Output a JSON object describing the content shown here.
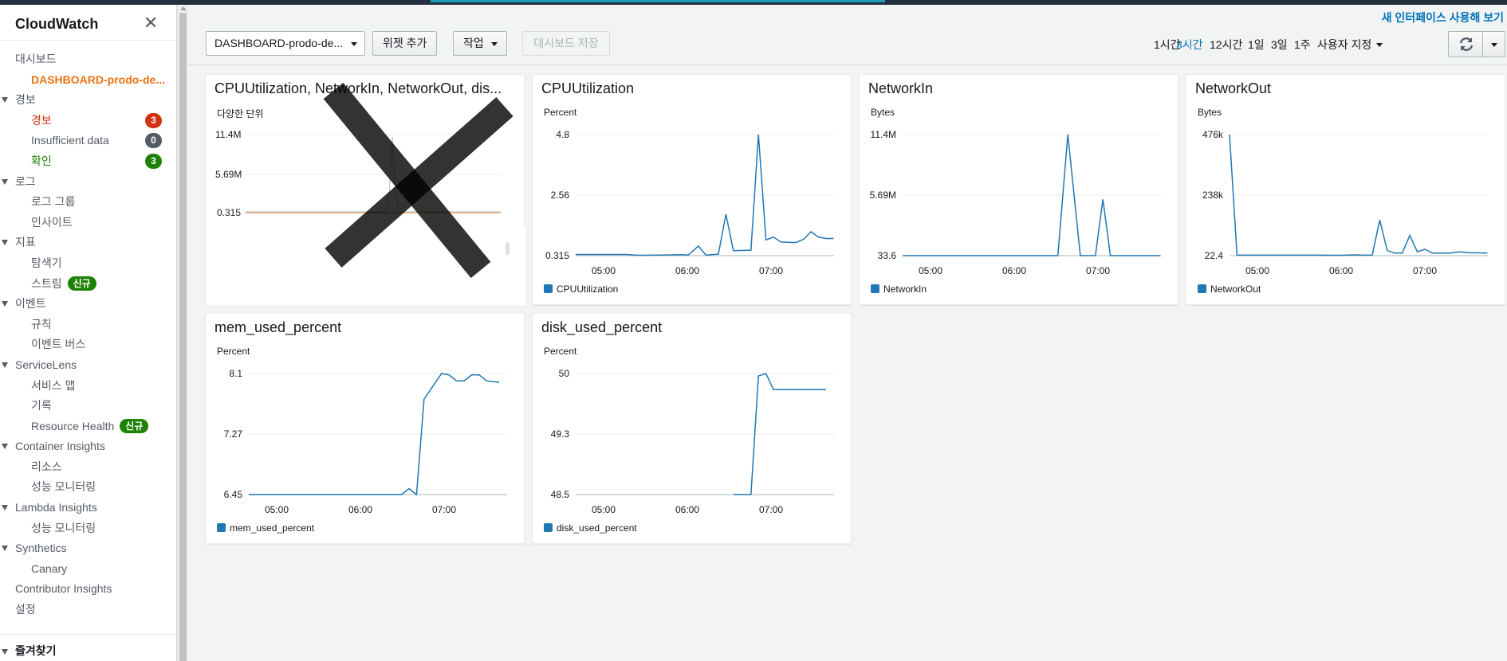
{
  "sidebar": {
    "title": "CloudWatch",
    "items": [
      {
        "label": "대시보드",
        "level": 1,
        "caret": false,
        "style": ""
      },
      {
        "label": "DASHBOARD-prodo-de...",
        "level": 2,
        "caret": false,
        "style": "active"
      },
      {
        "label": "경보",
        "level": 1,
        "caret": true,
        "style": ""
      },
      {
        "label": "경보",
        "level": 2,
        "caret": false,
        "style": "alarm",
        "count": "3",
        "count_color": "red"
      },
      {
        "label": "Insufficient data",
        "level": 2,
        "caret": false,
        "style": "",
        "count": "0",
        "count_color": "gray"
      },
      {
        "label": "확인",
        "level": 2,
        "caret": false,
        "style": "ok",
        "count": "3",
        "count_color": "green"
      },
      {
        "label": "로그",
        "level": 1,
        "caret": true,
        "style": ""
      },
      {
        "label": "로그 그룹",
        "level": 2,
        "caret": false,
        "style": ""
      },
      {
        "label": "인사이트",
        "level": 2,
        "caret": false,
        "style": ""
      },
      {
        "label": "지표",
        "level": 1,
        "caret": true,
        "style": ""
      },
      {
        "label": "탐색기",
        "level": 2,
        "caret": false,
        "style": ""
      },
      {
        "label": "스트림",
        "level": 2,
        "caret": false,
        "style": "",
        "badge": "신규"
      },
      {
        "label": "이벤트",
        "level": 1,
        "caret": true,
        "style": ""
      },
      {
        "label": "규칙",
        "level": 2,
        "caret": false,
        "style": ""
      },
      {
        "label": "이벤트 버스",
        "level": 2,
        "caret": false,
        "style": ""
      },
      {
        "label": "ServiceLens",
        "level": 1,
        "caret": true,
        "style": ""
      },
      {
        "label": "서비스 맵",
        "level": 2,
        "caret": false,
        "style": ""
      },
      {
        "label": "기록",
        "level": 2,
        "caret": false,
        "style": ""
      },
      {
        "label": "Resource Health",
        "level": 2,
        "caret": false,
        "style": "",
        "badge": "신규"
      },
      {
        "label": "Container Insights",
        "level": 1,
        "caret": true,
        "style": ""
      },
      {
        "label": "리소스",
        "level": 2,
        "caret": false,
        "style": ""
      },
      {
        "label": "성능 모니터링",
        "level": 2,
        "caret": false,
        "style": ""
      },
      {
        "label": "Lambda Insights",
        "level": 1,
        "caret": true,
        "style": ""
      },
      {
        "label": "성능 모니터링",
        "level": 2,
        "caret": false,
        "style": ""
      },
      {
        "label": "Synthetics",
        "level": 1,
        "caret": true,
        "style": ""
      },
      {
        "label": "Canary",
        "level": 2,
        "caret": false,
        "style": ""
      },
      {
        "label": "Contributor Insights",
        "level": 1,
        "caret": false,
        "style": ""
      },
      {
        "label": "설정",
        "level": 1,
        "caret": false,
        "style": ""
      }
    ],
    "favorites": "즐겨찾기"
  },
  "header": {
    "new_ui_link": "새 인터페이스 사용해 보기",
    "dashboard_select": "DASHBOARD-prodo-de...",
    "add_widget": "위젯 추가",
    "actions": "작업",
    "save_dashboard": "대시보드 저장",
    "time_ranges": [
      {
        "label": "1시간",
        "selected": false
      },
      {
        "label": "3시간",
        "selected": true
      },
      {
        "label": "12시간",
        "selected": false
      },
      {
        "label": "1일",
        "selected": false
      },
      {
        "label": "3일",
        "selected": false
      },
      {
        "label": "1주",
        "selected": false
      },
      {
        "label": "사용자 지정",
        "selected": false,
        "dropdown": true
      }
    ]
  },
  "widgets": {
    "combined": {
      "title": "CPUUtilization, NetworkIn, NetworkOut, dis...",
      "unit": "다양한 단위",
      "y_ticks": [
        "11.4M",
        "5.69M",
        "0.315"
      ],
      "crossed_out": true
    },
    "cpu": {
      "title": "CPUUtilization",
      "legend": "CPUUtilization"
    },
    "netin": {
      "title": "NetworkIn",
      "legend": "NetworkIn"
    },
    "netout": {
      "title": "NetworkOut",
      "legend": "NetworkOut"
    },
    "mem": {
      "title": "mem_used_percent",
      "legend": "mem_used_percent"
    },
    "disk": {
      "title": "disk_used_percent",
      "legend": "disk_used_percent"
    }
  },
  "chart_data": [
    {
      "id": "cpu",
      "type": "line",
      "title": "CPUUtilization",
      "ylabel": "Percent",
      "ylim": [
        0.315,
        4.8
      ],
      "y_ticks": [
        "4.8",
        "2.56",
        "0.315"
      ],
      "x_ticks": [
        "05:00",
        "06:00",
        "07:00"
      ],
      "color": "#1f77b4",
      "series": [
        {
          "name": "CPUUtilization",
          "points": [
            [
              0,
              0.36
            ],
            [
              0.06,
              0.36
            ],
            [
              0.13,
              0.36
            ],
            [
              0.2,
              0.36
            ],
            [
              0.25,
              0.33
            ],
            [
              0.35,
              0.34
            ],
            [
              0.42,
              0.35
            ],
            [
              0.45,
              0.34
            ],
            [
              0.49,
              0.67
            ],
            [
              0.52,
              0.34
            ],
            [
              0.57,
              0.37
            ],
            [
              0.6,
              1.85
            ],
            [
              0.63,
              0.5
            ],
            [
              0.7,
              0.52
            ],
            [
              0.73,
              4.8
            ],
            [
              0.76,
              0.9
            ],
            [
              0.79,
              1.0
            ],
            [
              0.82,
              0.82
            ],
            [
              0.88,
              0.8
            ],
            [
              0.91,
              0.92
            ],
            [
              0.94,
              1.2
            ],
            [
              0.97,
              1.0
            ],
            [
              1.0,
              0.95
            ],
            [
              1.03,
              0.95
            ]
          ]
        }
      ]
    },
    {
      "id": "netin",
      "type": "line",
      "title": "NetworkIn",
      "ylabel": "Bytes",
      "ylim": [
        33.6,
        11400000
      ],
      "y_ticks": [
        "11.4M",
        "5.69M",
        "33.6"
      ],
      "x_ticks": [
        "05:00",
        "06:00",
        "07:00"
      ],
      "color": "#1f77b4",
      "series": [
        {
          "name": "NetworkIn",
          "points": [
            [
              0,
              33.6
            ],
            [
              0.55,
              33.6
            ],
            [
              0.62,
              33.6
            ],
            [
              0.66,
              11400000
            ],
            [
              0.71,
              33.6
            ],
            [
              0.77,
              33.6
            ],
            [
              0.8,
              5300000
            ],
            [
              0.83,
              33.6
            ],
            [
              1.03,
              33.6
            ]
          ]
        }
      ]
    },
    {
      "id": "netout",
      "type": "line",
      "title": "NetworkOut",
      "ylabel": "Bytes",
      "ylim": [
        22.4,
        476000
      ],
      "y_ticks": [
        "476k",
        "238k",
        "22.4"
      ],
      "x_ticks": [
        "05:00",
        "06:00",
        "07:00"
      ],
      "color": "#1f77b4",
      "series": [
        {
          "name": "NetworkOut",
          "points": [
            [
              0,
              476000
            ],
            [
              0.03,
              2000
            ],
            [
              0.15,
              2000
            ],
            [
              0.3,
              1800
            ],
            [
              0.45,
              1500
            ],
            [
              0.5,
              3000
            ],
            [
              0.53,
              2000
            ],
            [
              0.57,
              2500
            ],
            [
              0.6,
              140000
            ],
            [
              0.63,
              20000
            ],
            [
              0.66,
              10000
            ],
            [
              0.69,
              10000
            ],
            [
              0.72,
              80000
            ],
            [
              0.75,
              15000
            ],
            [
              0.78,
              25000
            ],
            [
              0.81,
              10000
            ],
            [
              0.84,
              10000
            ],
            [
              0.88,
              10000
            ],
            [
              0.92,
              15000
            ],
            [
              0.95,
              12000
            ],
            [
              1.03,
              10000
            ]
          ]
        }
      ]
    },
    {
      "id": "mem",
      "type": "line",
      "title": "mem_used_percent",
      "ylabel": "Percent",
      "ylim": [
        6.45,
        8.1
      ],
      "y_ticks": [
        "8.1",
        "7.27",
        "6.45"
      ],
      "x_ticks": [
        "05:00",
        "06:00",
        "07:00"
      ],
      "color": "#1f77b4",
      "series": [
        {
          "name": "mem_used_percent",
          "points": [
            [
              0,
              6.45
            ],
            [
              0.5,
              6.45
            ],
            [
              0.61,
              6.45
            ],
            [
              0.64,
              6.53
            ],
            [
              0.67,
              6.45
            ],
            [
              0.7,
              7.75
            ],
            [
              0.77,
              8.1
            ],
            [
              0.8,
              8.08
            ],
            [
              0.83,
              8.0
            ],
            [
              0.86,
              8.0
            ],
            [
              0.89,
              8.08
            ],
            [
              0.92,
              8.08
            ],
            [
              0.95,
              8.0
            ],
            [
              1.0,
              7.98
            ]
          ]
        }
      ]
    },
    {
      "id": "disk",
      "type": "line",
      "title": "disk_used_percent",
      "ylabel": "Percent",
      "ylim": [
        48.5,
        50
      ],
      "y_ticks": [
        "50",
        "49.3",
        "48.5"
      ],
      "x_ticks": [
        "05:00",
        "06:00",
        "07:00"
      ],
      "color": "#1f77b4",
      "series": [
        {
          "name": "disk_used_percent",
          "points": [
            [
              0.63,
              48.5
            ],
            [
              0.7,
              48.5
            ],
            [
              0.73,
              49.97
            ],
            [
              0.76,
              50.0
            ],
            [
              0.79,
              49.8
            ],
            [
              0.85,
              49.8
            ],
            [
              0.95,
              49.8
            ],
            [
              1.0,
              49.8
            ]
          ]
        }
      ]
    }
  ]
}
